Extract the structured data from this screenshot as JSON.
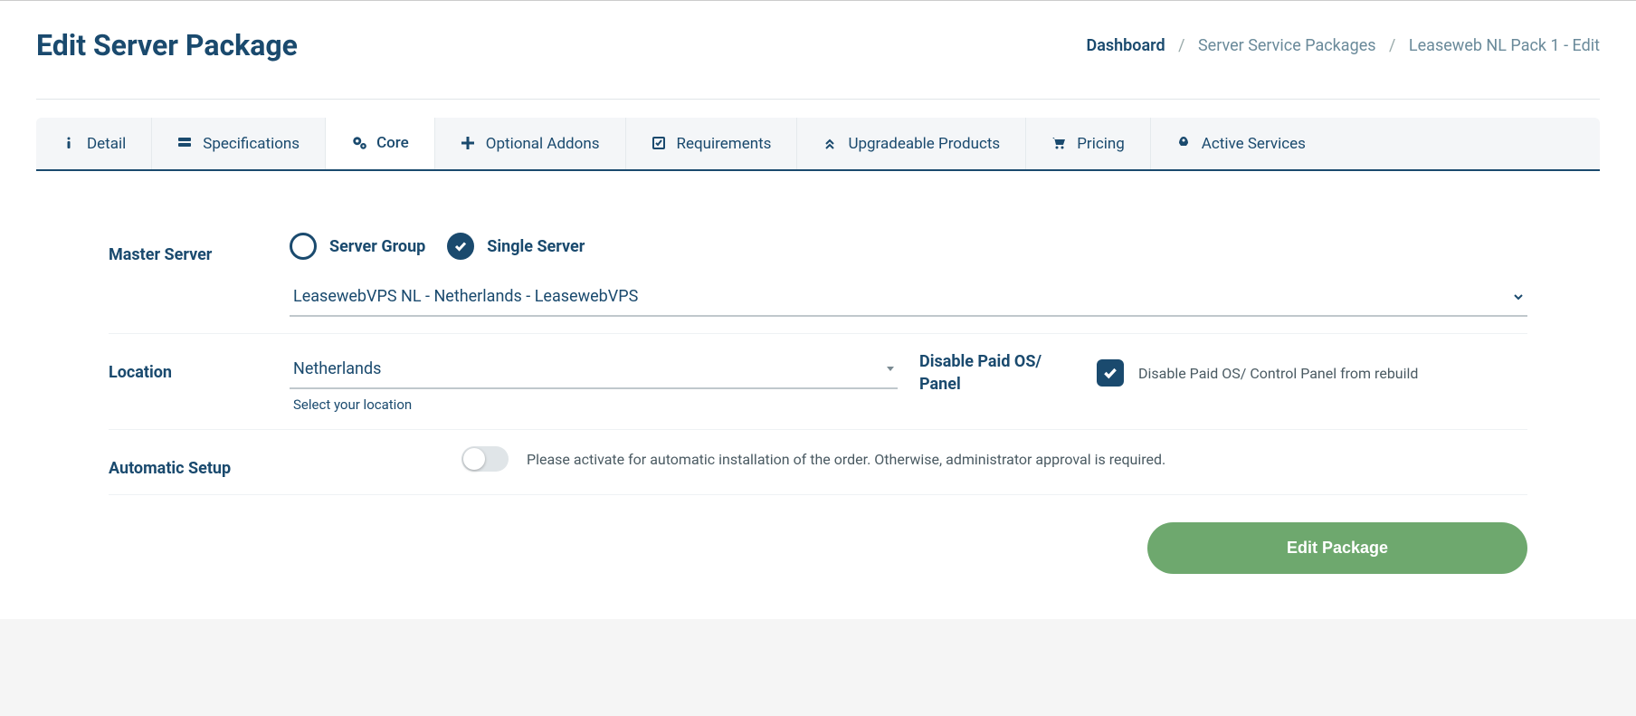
{
  "header": {
    "title": "Edit Server Package",
    "breadcrumb": {
      "root": "Dashboard",
      "mid": "Server Service Packages",
      "leaf": "Leaseweb NL Pack 1 - Edit"
    }
  },
  "tabs": [
    {
      "label": "Detail"
    },
    {
      "label": "Specifications"
    },
    {
      "label": "Core"
    },
    {
      "label": "Optional Addons"
    },
    {
      "label": "Requirements"
    },
    {
      "label": "Upgradeable Products"
    },
    {
      "label": "Pricing"
    },
    {
      "label": "Active Services"
    }
  ],
  "form": {
    "master_server": {
      "label": "Master Server",
      "radio_group": "Server Group",
      "radio_single": "Single Server",
      "selected": "LeasewebVPS NL - Netherlands - LeasewebVPS"
    },
    "location": {
      "label": "Location",
      "value": "Netherlands",
      "hint": "Select your location"
    },
    "disable_paid": {
      "label": "Disable Paid OS/ Panel",
      "text": "Disable Paid OS/ Control Panel from rebuild"
    },
    "auto_setup": {
      "label": "Automatic Setup",
      "text": "Please activate for automatic installation of the order. Otherwise, administrator approval is required."
    }
  },
  "buttons": {
    "edit": "Edit Package"
  }
}
